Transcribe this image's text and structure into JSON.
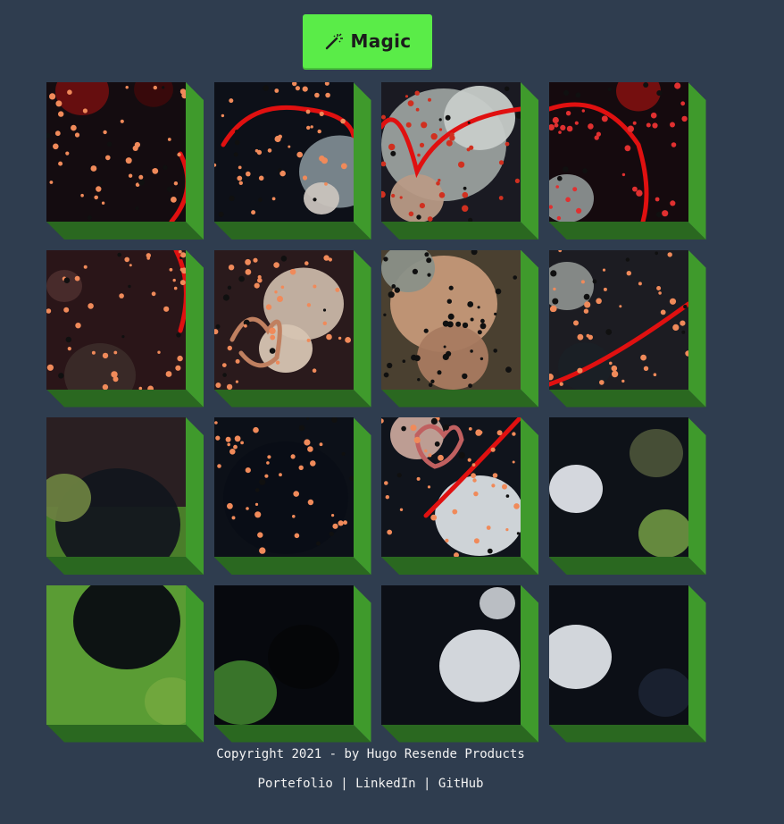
{
  "toolbar": {
    "magic_label": "Magic",
    "magic_icon": "magic-wand-icon"
  },
  "puzzle": {
    "rows": 4,
    "cols": 4,
    "tile_color_side": "#3f9a2c",
    "tile_color_bottom": "#2a6820",
    "image": "stadium-heart-celebration"
  },
  "footer": {
    "copyright": "Copyright 2021 - by Hugo Resende Products",
    "links": [
      "Portefolio",
      "LinkedIn",
      "GitHub"
    ],
    "separator": "|"
  },
  "colors": {
    "background": "#2f3d4f",
    "accent": "#5aec48",
    "text": "#f2f2f2"
  }
}
